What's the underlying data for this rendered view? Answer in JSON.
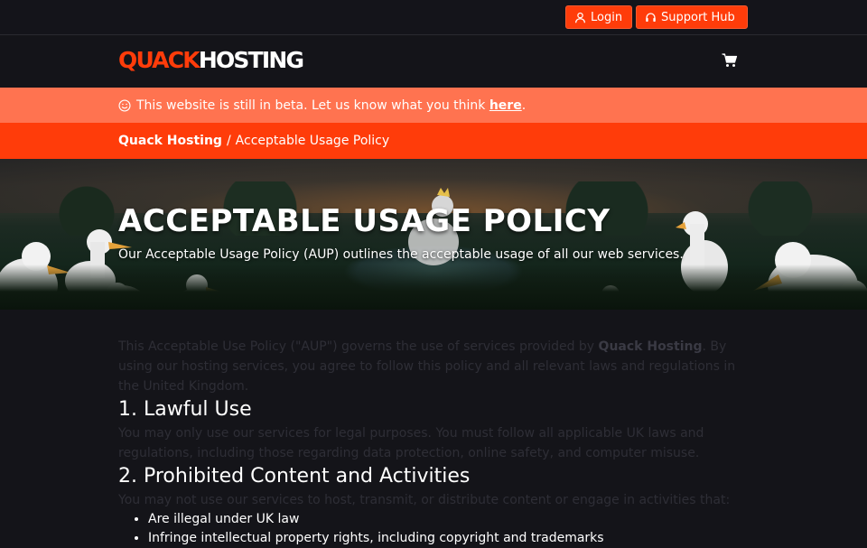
{
  "topbar": {
    "login_label": "Login",
    "support_label": "Support Hub"
  },
  "brand": {
    "part1": "QUACK",
    "part2": "HOSTING",
    "accent": "#ff3c0a"
  },
  "beta": {
    "text_before": "This website is still in beta. Let us know what you think",
    "link_label": "here",
    "text_after": "."
  },
  "breadcrumb": {
    "home": "Quack Hosting",
    "separator": "/",
    "current": "Acceptable Usage Policy"
  },
  "hero": {
    "title": "ACCEPTABLE USAGE POLICY",
    "subtitle": "Our Acceptable Usage Policy (AUP) outlines the acceptable usage of all our web services."
  },
  "content": {
    "intro_before": "This Acceptable Use Policy (\"AUP\") governs the use of services provided by",
    "intro_company": "Quack Hosting",
    "intro_after": ". By using our hosting services, you agree to follow this policy and all relevant laws and regulations in the United Kingdom.",
    "section1_title": "1. Lawful Use",
    "section1_text": "You may only use our services for legal purposes. You must follow all applicable UK laws and regulations, including those regarding data protection, online safety, and computer misuse.",
    "section2_title": "2. Prohibited Content and Activities",
    "section2_text": "You may not use our services to host, transmit, or distribute content or engage in activities that:",
    "section2_items": [
      "Are illegal under UK law",
      "Infringe intellectual property rights, including copyright and trademarks"
    ]
  }
}
